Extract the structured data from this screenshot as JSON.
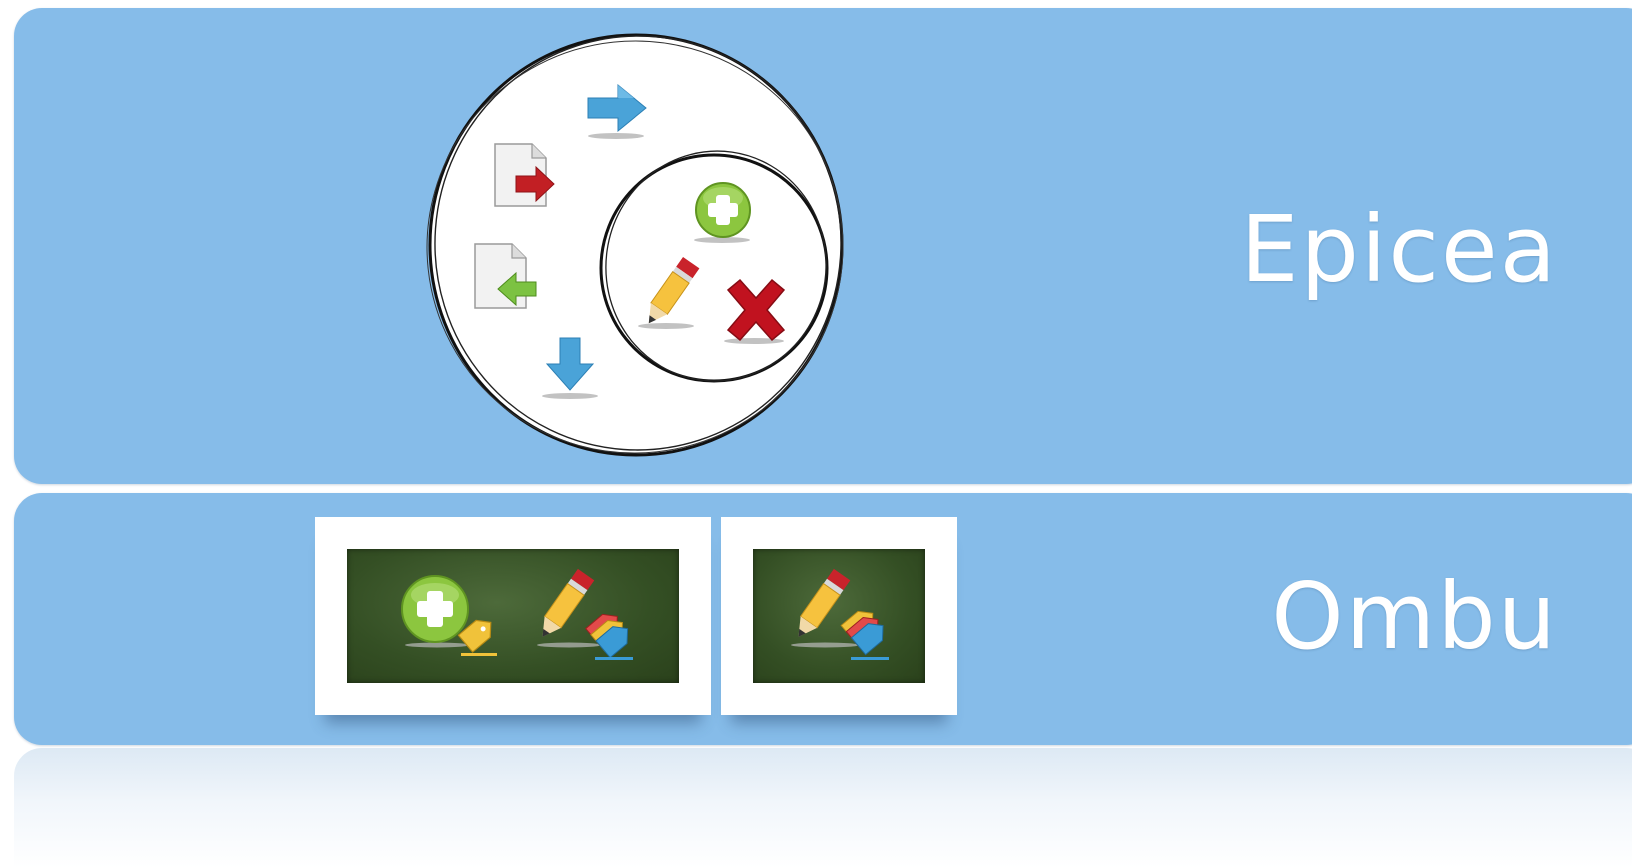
{
  "panels": [
    {
      "title": "Epicea"
    },
    {
      "title": "Ombu"
    }
  ],
  "colors": {
    "panel_blue": "#86bce9",
    "title_white": "#ffffff",
    "board_green": "#344f24",
    "add_green": "#8cc63f",
    "delete_red": "#c1121f",
    "arrow_blue": "#4a9fd6"
  },
  "icons": {
    "venn_outer": [
      "arrow-right-icon",
      "export-file-icon",
      "import-file-icon",
      "arrow-down-icon"
    ],
    "venn_inner": [
      "add-icon",
      "edit-pencil-icon",
      "delete-x-icon"
    ],
    "ombu_wide": [
      "add-tag-icon",
      "edit-tags-icon"
    ],
    "ombu_narrow": [
      "edit-tags-icon"
    ]
  }
}
